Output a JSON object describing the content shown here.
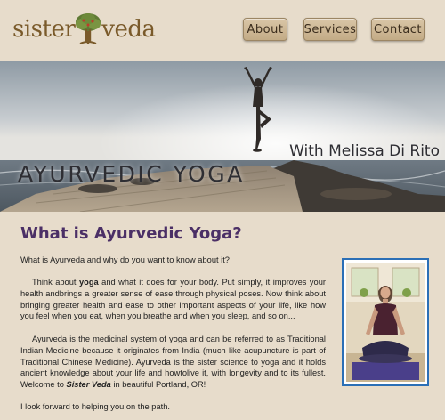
{
  "brand": {
    "logo_text_left": "sister",
    "logo_text_right": "veda"
  },
  "nav": [
    {
      "label": "About"
    },
    {
      "label": "Services"
    },
    {
      "label": "Contact"
    }
  ],
  "banner": {
    "title": "AYURVEDIC YOGA",
    "subtitle": "With Melissa Di Rito"
  },
  "main": {
    "heading": "What is Ayurvedic Yoga?",
    "intro": "What is Ayurveda and why do you want to know about it?",
    "para1": {
      "pre": "Think about ",
      "bold": "yoga",
      "post": " and what it does for your body. Put simply, it improves your health andbrings a greater sense of ease through physical poses. Now think about bringing greater health and ease to other important aspects of your life, like how you feel when you eat, when you breathe and when you sleep, and so on..."
    },
    "para2": {
      "pre": "Ayurveda is the medicinal system of yoga and can be referred to as Traditional Indian Medicine because it originates from India (much like acupuncture is part of Traditional Chinese Medicine). Ayurveda is the sister science to yoga and it holds ancient knowledge about your life and howtolive it, with longevity and to its fullest. Welcome to ",
      "bold": "Sister Veda",
      "post": " in beautiful Portland, OR!"
    },
    "closing": "I look forward to helping you on the path."
  },
  "colors": {
    "background": "#e7dccb",
    "heading": "#4b2f66",
    "photo_border": "#2b6fb6",
    "button": "#cdb895"
  }
}
